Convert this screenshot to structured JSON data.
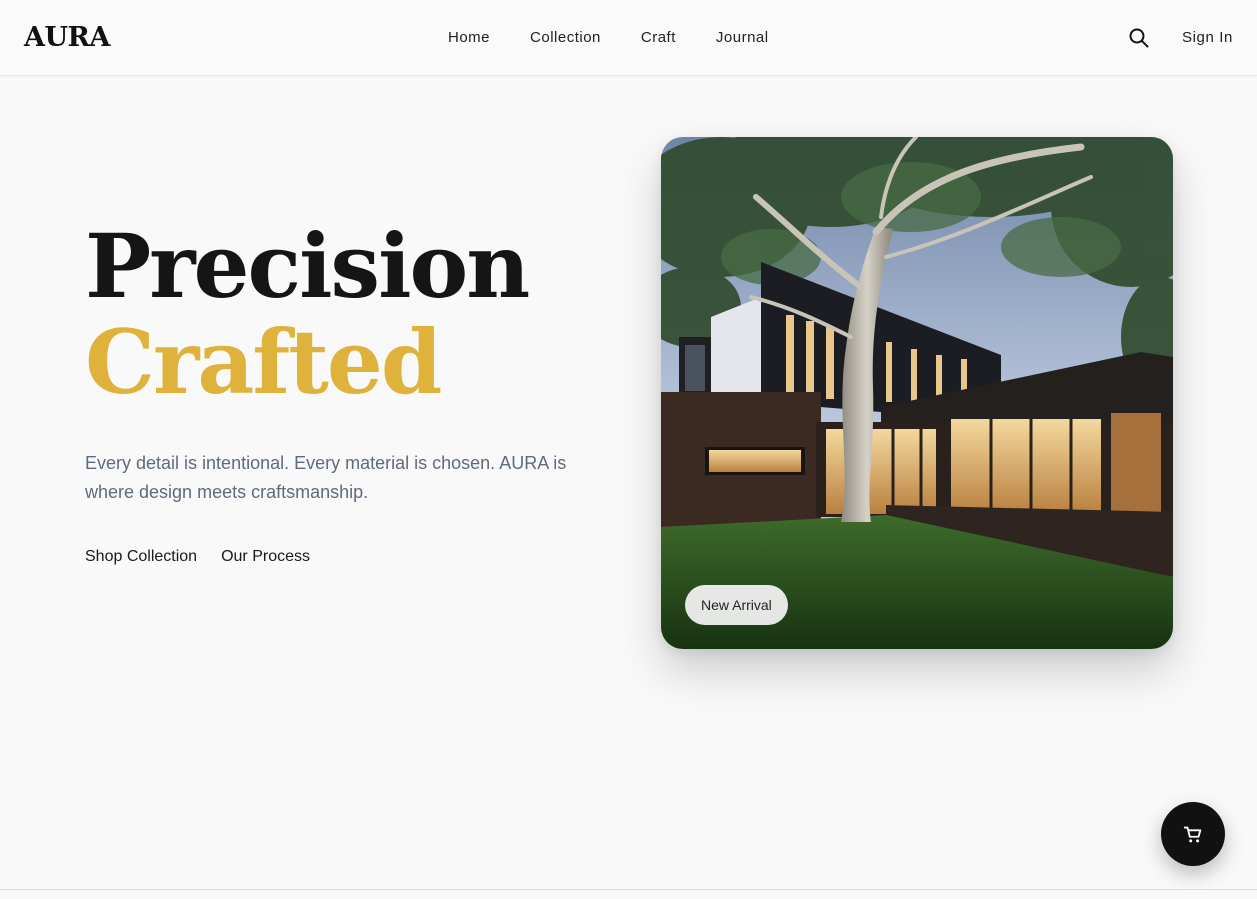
{
  "header": {
    "logo": "AURA",
    "nav": [
      "Home",
      "Collection",
      "Craft",
      "Journal"
    ],
    "search_icon": "search-icon",
    "sign_in": "Sign In"
  },
  "hero": {
    "title_line1": "Precision",
    "title_line2": "Crafted",
    "description": "Every detail is intentional. Every material is chosen. AURA is where design meets craftsmanship.",
    "links": [
      "Shop Collection",
      "Our Process"
    ],
    "badge": "New Arrival"
  },
  "cart": {
    "icon": "cart-icon"
  },
  "colors": {
    "accent": "#dfb23c",
    "dark": "#111111",
    "muted_text": "#5e6b7c",
    "background": "#f9f9f9"
  }
}
